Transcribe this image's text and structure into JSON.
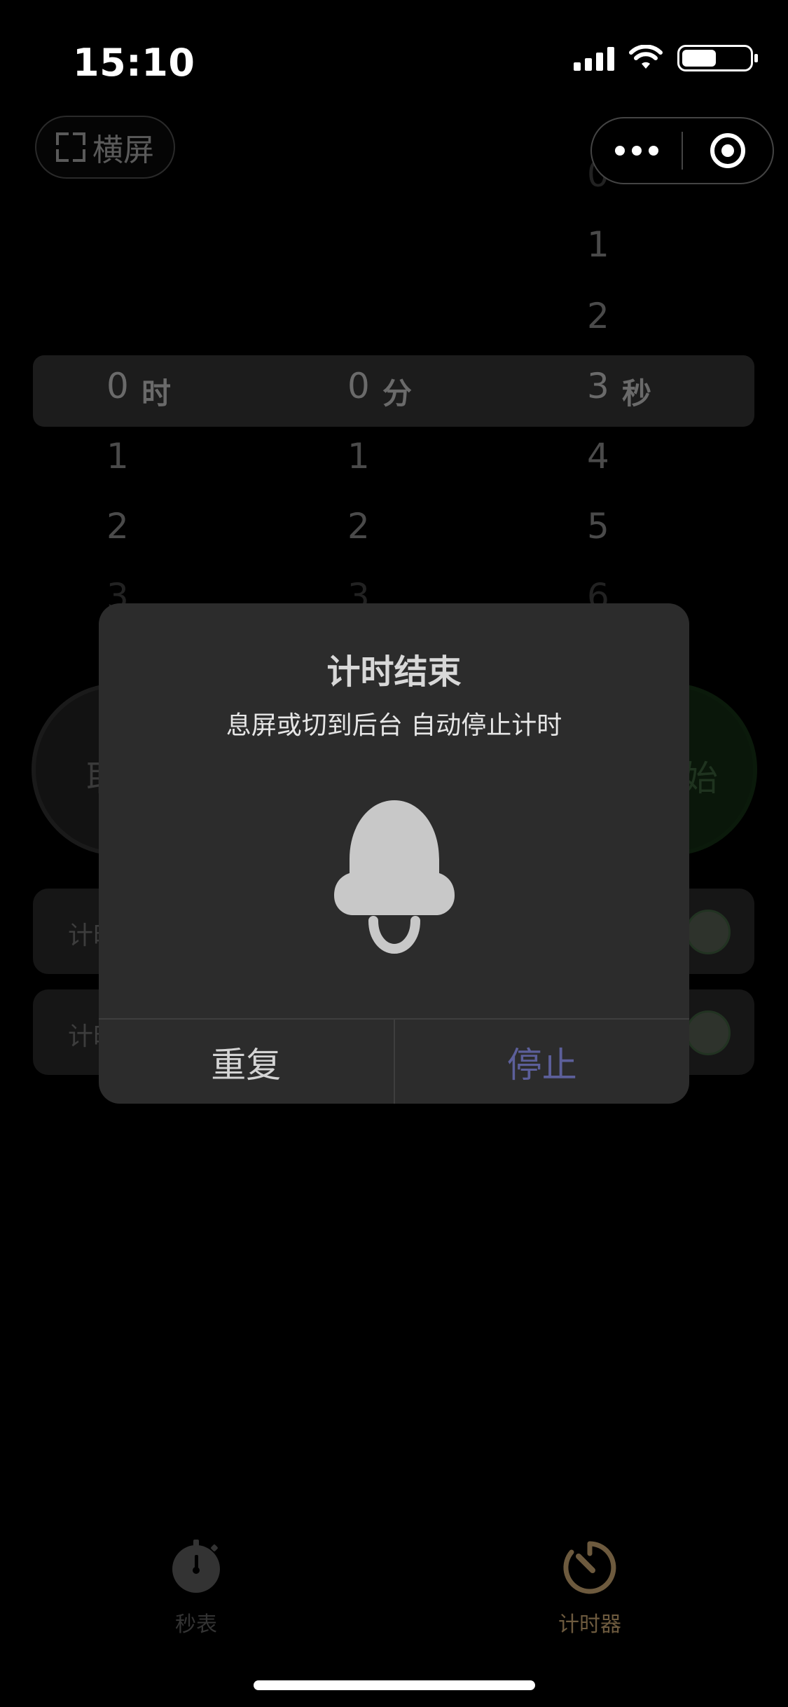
{
  "status_bar": {
    "time": "15:10"
  },
  "top": {
    "landscape_label": "横屏"
  },
  "picker": {
    "hours": {
      "unit": "时",
      "above": [],
      "selected": "0",
      "below": [
        "1",
        "2",
        "3"
      ]
    },
    "minutes": {
      "unit": "分",
      "above": [],
      "selected": "0",
      "below": [
        "1",
        "2",
        "3"
      ]
    },
    "seconds": {
      "unit": "秒",
      "above": [
        "0",
        "1",
        "2"
      ],
      "selected": "3",
      "below": [
        "4",
        "5",
        "6"
      ]
    }
  },
  "actions": {
    "cancel_label": "取",
    "start_label": "始"
  },
  "settings": {
    "row1_label": "计时",
    "row2_label": "计时"
  },
  "dialog": {
    "title": "计时结束",
    "message": "息屏或切到后台  自动停止计时",
    "repeat_label": "重复",
    "stop_label": "停止"
  },
  "tabbar": {
    "tabs": [
      {
        "label": "秒表",
        "icon": "stopwatch-icon",
        "active": false
      },
      {
        "label": "计时器",
        "icon": "timer-icon",
        "active": true
      }
    ]
  },
  "colors": {
    "stop_text": "#5c5f9a",
    "timer_accent": "#6d5a3e"
  }
}
